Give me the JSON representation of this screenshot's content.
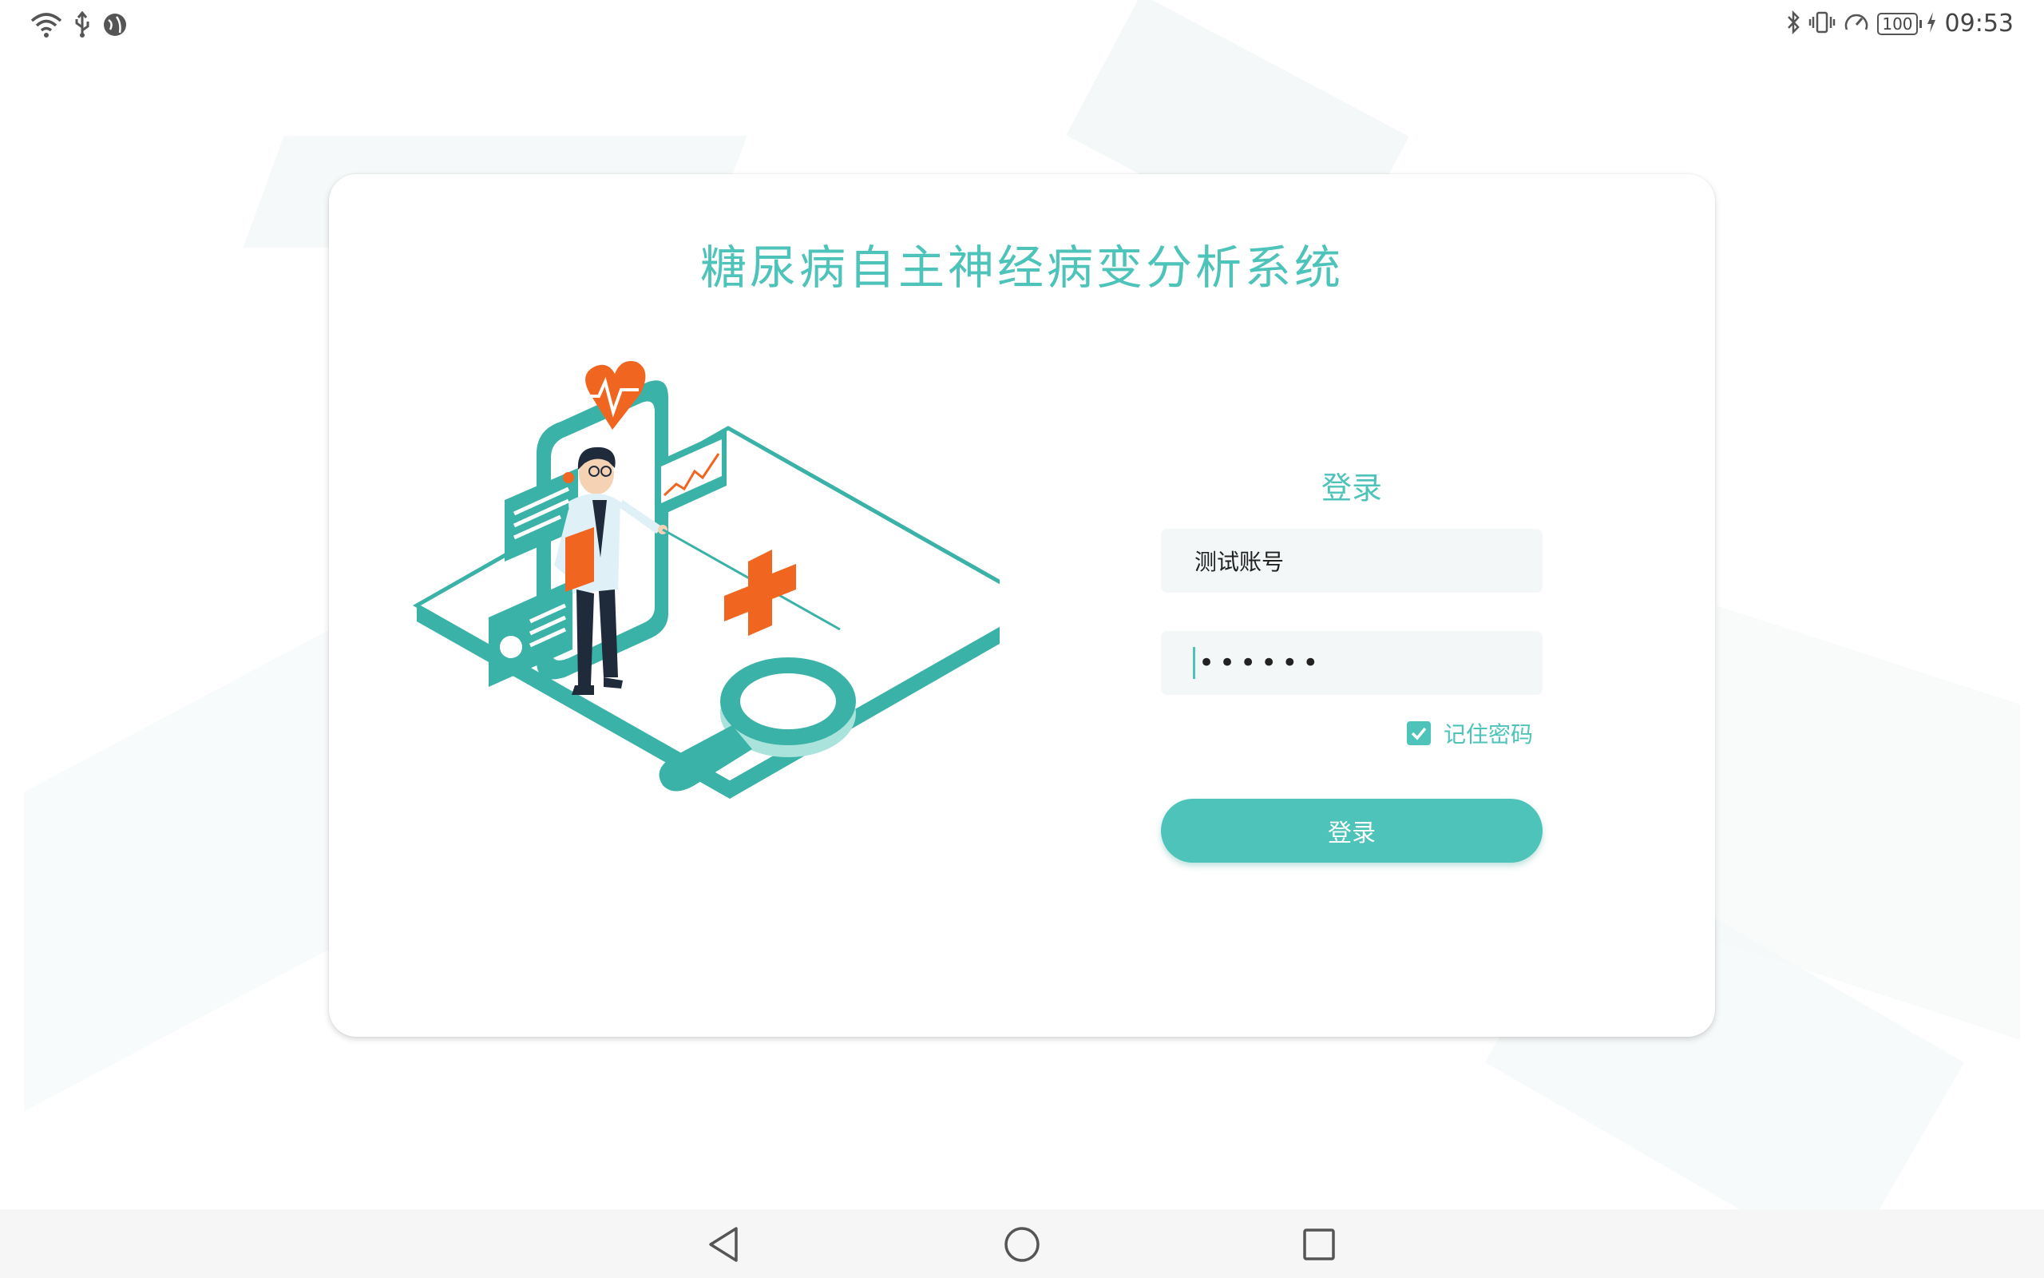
{
  "status_bar": {
    "left_icons": [
      "wifi-icon",
      "usb-icon",
      "vpn-globe-icon"
    ],
    "right_icons": [
      "bluetooth-icon",
      "vibrate-icon",
      "data-saver-icon"
    ],
    "battery_level": "100",
    "time": "09:53"
  },
  "app": {
    "title": "糖尿病自主神经病变分析系统"
  },
  "login": {
    "heading": "登录",
    "username_value": "测试账号",
    "password_value": "••••••",
    "remember_checked": true,
    "remember_label": "记住密码",
    "submit_label": "登录"
  },
  "nav_bar": {
    "icons": [
      "back-icon",
      "home-icon",
      "recents-icon"
    ]
  },
  "colors": {
    "accent": "#4ec3b9",
    "accent_dark": "#35a99f",
    "illustration_orange": "#f0651f",
    "field_bg": "#f3f7f7"
  }
}
